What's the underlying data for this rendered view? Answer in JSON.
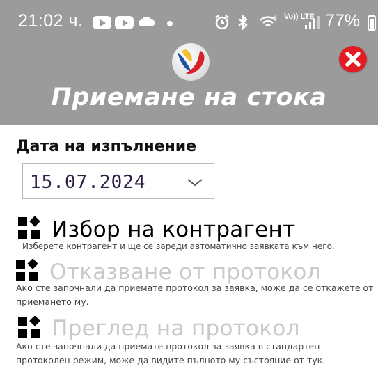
{
  "status_bar": {
    "time": "21:02 ч.",
    "network_label": "Vo)) LTE",
    "network_gen": "6",
    "battery": "77%"
  },
  "header": {
    "title": "Приемане на стока",
    "close_color": "#e31b23"
  },
  "date_field": {
    "label": "Дата на изпълнение",
    "value": "15.07.2024"
  },
  "menu": [
    {
      "title": "Избор на контрагент",
      "description": "Изберете контрагент и ще се зареди автоматично заявката към него.",
      "enabled": true,
      "icon": "dashboard-grid-icon"
    },
    {
      "title": "Отказване от протокол",
      "description": "Ако сте започнали да приемате протокол за заявка, може да се откажете от приемането му.",
      "enabled": false,
      "icon": "dashboard-grid-icon"
    },
    {
      "title": "Преглед на протокол",
      "description": "Ако сте започнали да приемате протокол за заявка в стандартен протоколен режим, може да видите пълното му състояние от тук.",
      "enabled": false,
      "icon": "dashboard-grid-icon"
    }
  ],
  "colors": {
    "header_bg": "#9b9b9b",
    "disabled_text": "#c9c9c9"
  }
}
